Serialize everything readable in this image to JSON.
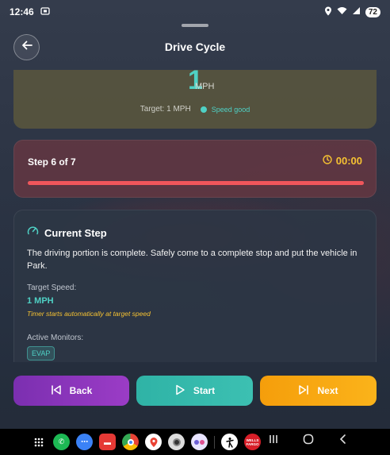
{
  "status": {
    "time": "12:46",
    "battery": "72"
  },
  "header": {
    "title": "Drive Cycle"
  },
  "speed": {
    "value": "1",
    "unit": "MPH",
    "target": "Target: 1 MPH",
    "status": "Speed good"
  },
  "step": {
    "label": "Step 6 of 7",
    "timer": "00:00",
    "progress": 1.0
  },
  "current_step": {
    "title": "Current Step",
    "description": "The driving portion is complete. Safely come to a complete stop and put the vehicle in Park.",
    "target_speed_label": "Target Speed:",
    "target_speed_value": "1 MPH",
    "timer_note": "Timer starts automatically at target speed",
    "monitors_label": "Active Monitors:",
    "monitors": [
      "EVAP"
    ]
  },
  "buttons": {
    "back": "Back",
    "start": "Start",
    "next": "Next"
  },
  "navbar": {
    "apps": [
      {
        "name": "app-drawer-icon",
        "color": "#000000"
      },
      {
        "name": "phone-icon",
        "color": "#1db954"
      },
      {
        "name": "messages-icon",
        "color": "#3b82f6"
      },
      {
        "name": "notes-icon",
        "color": "#e53935"
      },
      {
        "name": "chrome-icon",
        "color": "#f4b400"
      },
      {
        "name": "maps-icon",
        "color": "#34a853"
      },
      {
        "name": "camera-icon",
        "color": "#555555"
      },
      {
        "name": "dual-app-icon",
        "color": "#6d5fd6"
      },
      {
        "name": "accessibility-icon",
        "color": "#222222"
      },
      {
        "name": "wells-fargo-icon",
        "color": "#d71e28"
      }
    ],
    "wells_fargo_text": "WELLS FARGO"
  },
  "colors": {
    "accent_teal": "#4fd1c5",
    "accent_yellow": "#f6c232",
    "progress_red": "#f0565b",
    "back_purple": "#9b3cc6",
    "start_teal": "#3cc0b2",
    "next_orange": "#fbb31a"
  }
}
